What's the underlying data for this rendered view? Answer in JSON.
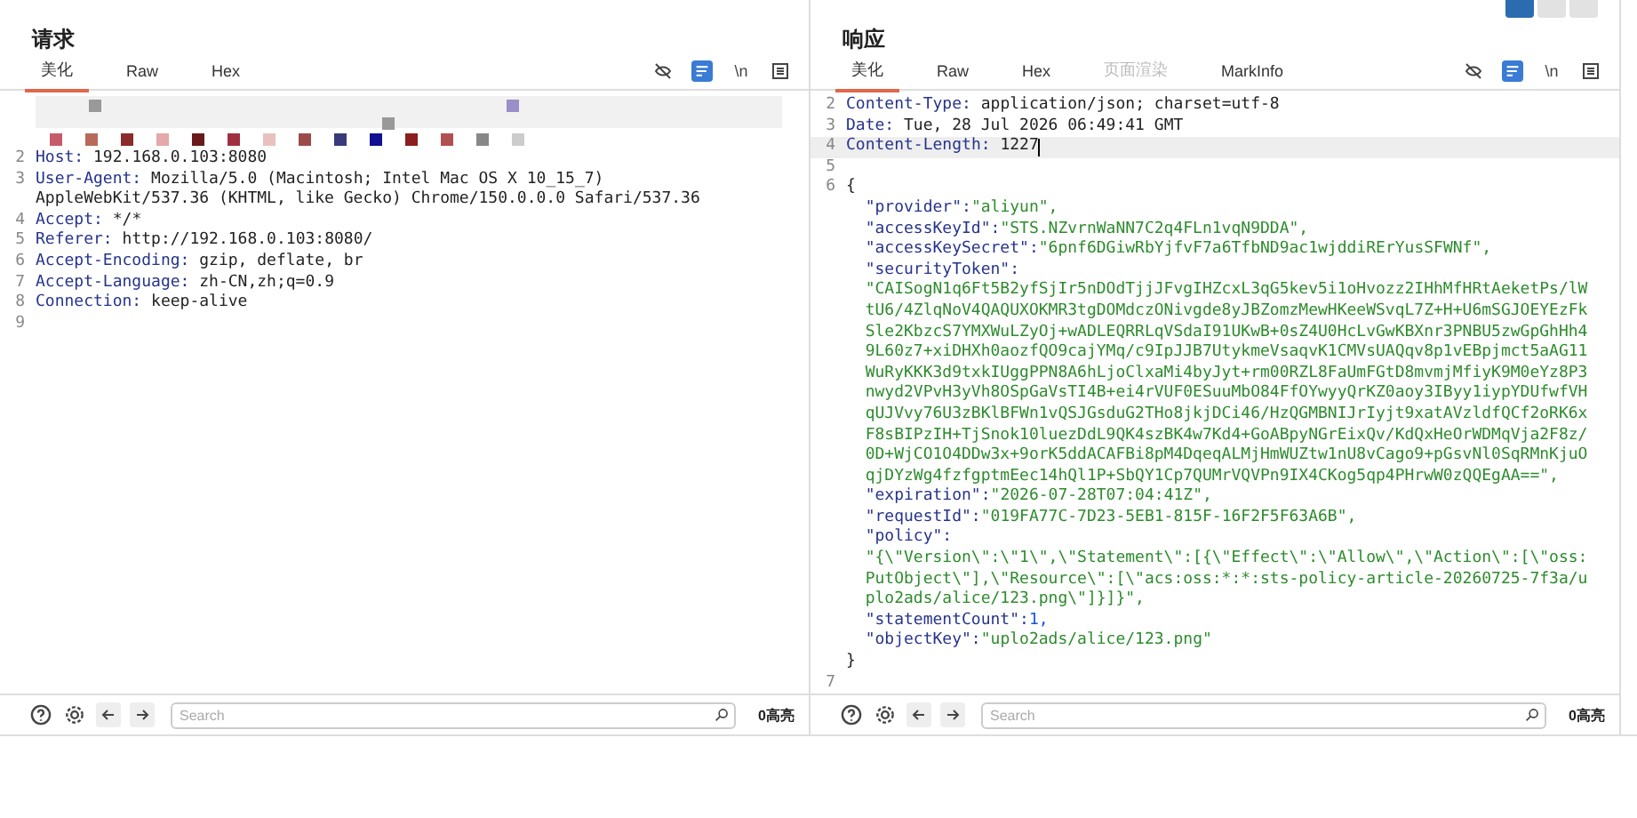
{
  "view_toggles": [
    {
      "selected": true
    },
    {
      "selected": false
    },
    {
      "selected": false
    }
  ],
  "request": {
    "title": "请求",
    "tabs": [
      {
        "label": "美化",
        "selected": true,
        "disabled": false
      },
      {
        "label": "Raw",
        "selected": false,
        "disabled": false
      },
      {
        "label": "Hex",
        "selected": false,
        "disabled": false
      }
    ],
    "wrap_on": true,
    "newline_label": "\\n",
    "redacted": true,
    "lines": [
      {
        "number": "2",
        "name": "Host:",
        "value": [
          "192.168.0.103:8080"
        ]
      },
      {
        "number": "3",
        "name": "User-Agent:",
        "value": [
          "Mozilla/5.0 (Macintosh; Intel Mac OS X 10_15_7)",
          "AppleWebKit/537.36 (KHTML, like Gecko) Chrome/150.0.0.0 Safari/537.36"
        ]
      },
      {
        "number": "4",
        "name": "Accept:",
        "value": [
          "*/*"
        ]
      },
      {
        "number": "5",
        "name": "Referer:",
        "value": [
          "http://192.168.0.103:8080/"
        ]
      },
      {
        "number": "6",
        "name": "Accept-Encoding:",
        "value": [
          "gzip, deflate, br"
        ]
      },
      {
        "number": "7",
        "name": "Accept-Language:",
        "value": [
          "zh-CN,zh;q=0.9"
        ]
      },
      {
        "number": "8",
        "name": "Connection:",
        "value": [
          "keep-alive"
        ]
      },
      {
        "number": "9"
      }
    ],
    "search": {
      "placeholder": "Search"
    },
    "highlight_count": "0高亮"
  },
  "response": {
    "title": "响应",
    "tabs": [
      {
        "label": "美化",
        "selected": true,
        "disabled": false
      },
      {
        "label": "Raw",
        "selected": false,
        "disabled": false
      },
      {
        "label": "Hex",
        "selected": false,
        "disabled": false
      },
      {
        "label": "页面渲染",
        "selected": false,
        "disabled": true
      },
      {
        "label": "MarkInfo",
        "selected": false,
        "disabled": false
      }
    ],
    "wrap_on": true,
    "newline_label": "\\n",
    "redacted": false,
    "lines": [
      {
        "number": "2",
        "name": "Content-Type:",
        "value": [
          "application/json; charset=utf-8"
        ]
      },
      {
        "number": "3",
        "name": "Date:",
        "value": [
          "Tue, 28 Jul 2026 06:49:41 GMT"
        ]
      },
      {
        "number": "4",
        "name": "Content-Length:",
        "value": [
          "1227"
        ],
        "current": true
      },
      {
        "number": "5"
      },
      {
        "number": "6",
        "open": "{",
        "close": "}",
        "fields": [
          {
            "key": "\"provider\":",
            "kind": "string",
            "inline": true,
            "value": [
              "\"aliyun\","
            ]
          },
          {
            "key": "\"accessKeyId\":",
            "kind": "string",
            "inline": true,
            "value": [
              "\"STS.NZvrnWaNN7C2q4FLn1vqN9DDA\","
            ]
          },
          {
            "key": "\"accessKeySecret\":",
            "kind": "string",
            "inline": true,
            "value": [
              "\"6pnf6DGiwRbYjfvF7a6TfbND9ac1wjddiRErYusSFWNf\","
            ]
          },
          {
            "key": "\"securityToken\":",
            "kind": "string",
            "inline": false,
            "value": [
              "\"CAISogN1q6Ft5B2yfSjIr5nDOdTjjJFvgIHZcxL3qG5kev5i1oHvozz2IHhMfHRtAeketPs/lW",
              "tU6/4ZlqNoV4QAQUXOKMR3tgDOMdczONivgde8yJBZomzMewHKeeWSvqL7Z+H+U6mSGJOEYEzFk",
              "Sle2KbzcS7YMXWuLZyOj+wADLEQRRLqVSdaI91UKwB+0sZ4U0HcLvGwKBXnr3PNBU5zwGpGhHh4",
              "9L60z7+xiDHXh0aozfQO9cajYMq/c9IpJJB7UtykmeVsaqvK1CMVsUAQqv8p1vEBpjmct5aAG11",
              "WuRyKKK3d9txkIUggPPN8A6hLjoClxaMi4byJyt+rm00RZL8FaUmFGtD8mvmjMfiyK9M0eYz8P3",
              "nwyd2VPvH3yVh8OSpGaVsTI4B+ei4rVUF0ESuuMbO84FfOYwyyQrKZ0aoy3IByy1iypYDUfwfVH",
              "qUJVvy76U3zBKlBFWn1vQSJGsduG2THo8jkjDCi46/HzQGMBNIJrIyjt9xatAVzldfQCf2oRK6x",
              "F8sBIPzIH+TjSnok10luezDdL9QK4szBK4w7Kd4+GoABpyNGrEixQv/KdQxHeOrWDMqVja2F8z/",
              "0D+WjCO1O4DDw3x+9orK5ddACAFBi8pM4DqeqALMjHmWUZtw1nU8vCago9+pGsvNl0SqRMnKjuO",
              "qjDYzWg4fzfgptmEec14hQl1P+SbQY1Cp7QUMrVQVPn9IX4CKog5qp4PHrwW0zQQEgAA==\","
            ]
          },
          {
            "key": "\"expiration\":",
            "kind": "string",
            "inline": true,
            "value": [
              "\"2026-07-28T07:04:41Z\","
            ]
          },
          {
            "key": "\"requestId\":",
            "kind": "string",
            "inline": true,
            "value": [
              "\"019FA77C-7D23-5EB1-815F-16F2F5F63A6B\","
            ]
          },
          {
            "key": "\"policy\":",
            "kind": "string",
            "inline": false,
            "value": [
              "\"{\\\"Version\\\":\\\"1\\\",\\\"Statement\\\":[{\\\"Effect\\\":\\\"Allow\\\",\\\"Action\\\":[\\\"oss:",
              "PutObject\\\"],\\\"Resource\\\":[\\\"acs:oss:*:*:sts-policy-article-20260725-7f3a/u",
              "plo2ads/alice/123.png\\\"]}]}\","
            ]
          },
          {
            "key": "\"statementCount\":",
            "kind": "number",
            "inline": true,
            "value": [
              "1,"
            ]
          },
          {
            "key": "\"objectKey\":",
            "kind": "string",
            "inline": true,
            "value": [
              "\"uplo2ads/alice/123.png\""
            ]
          }
        ]
      },
      {
        "number": "7"
      }
    ],
    "search": {
      "placeholder": "Search"
    },
    "highlight_count": "0高亮"
  }
}
